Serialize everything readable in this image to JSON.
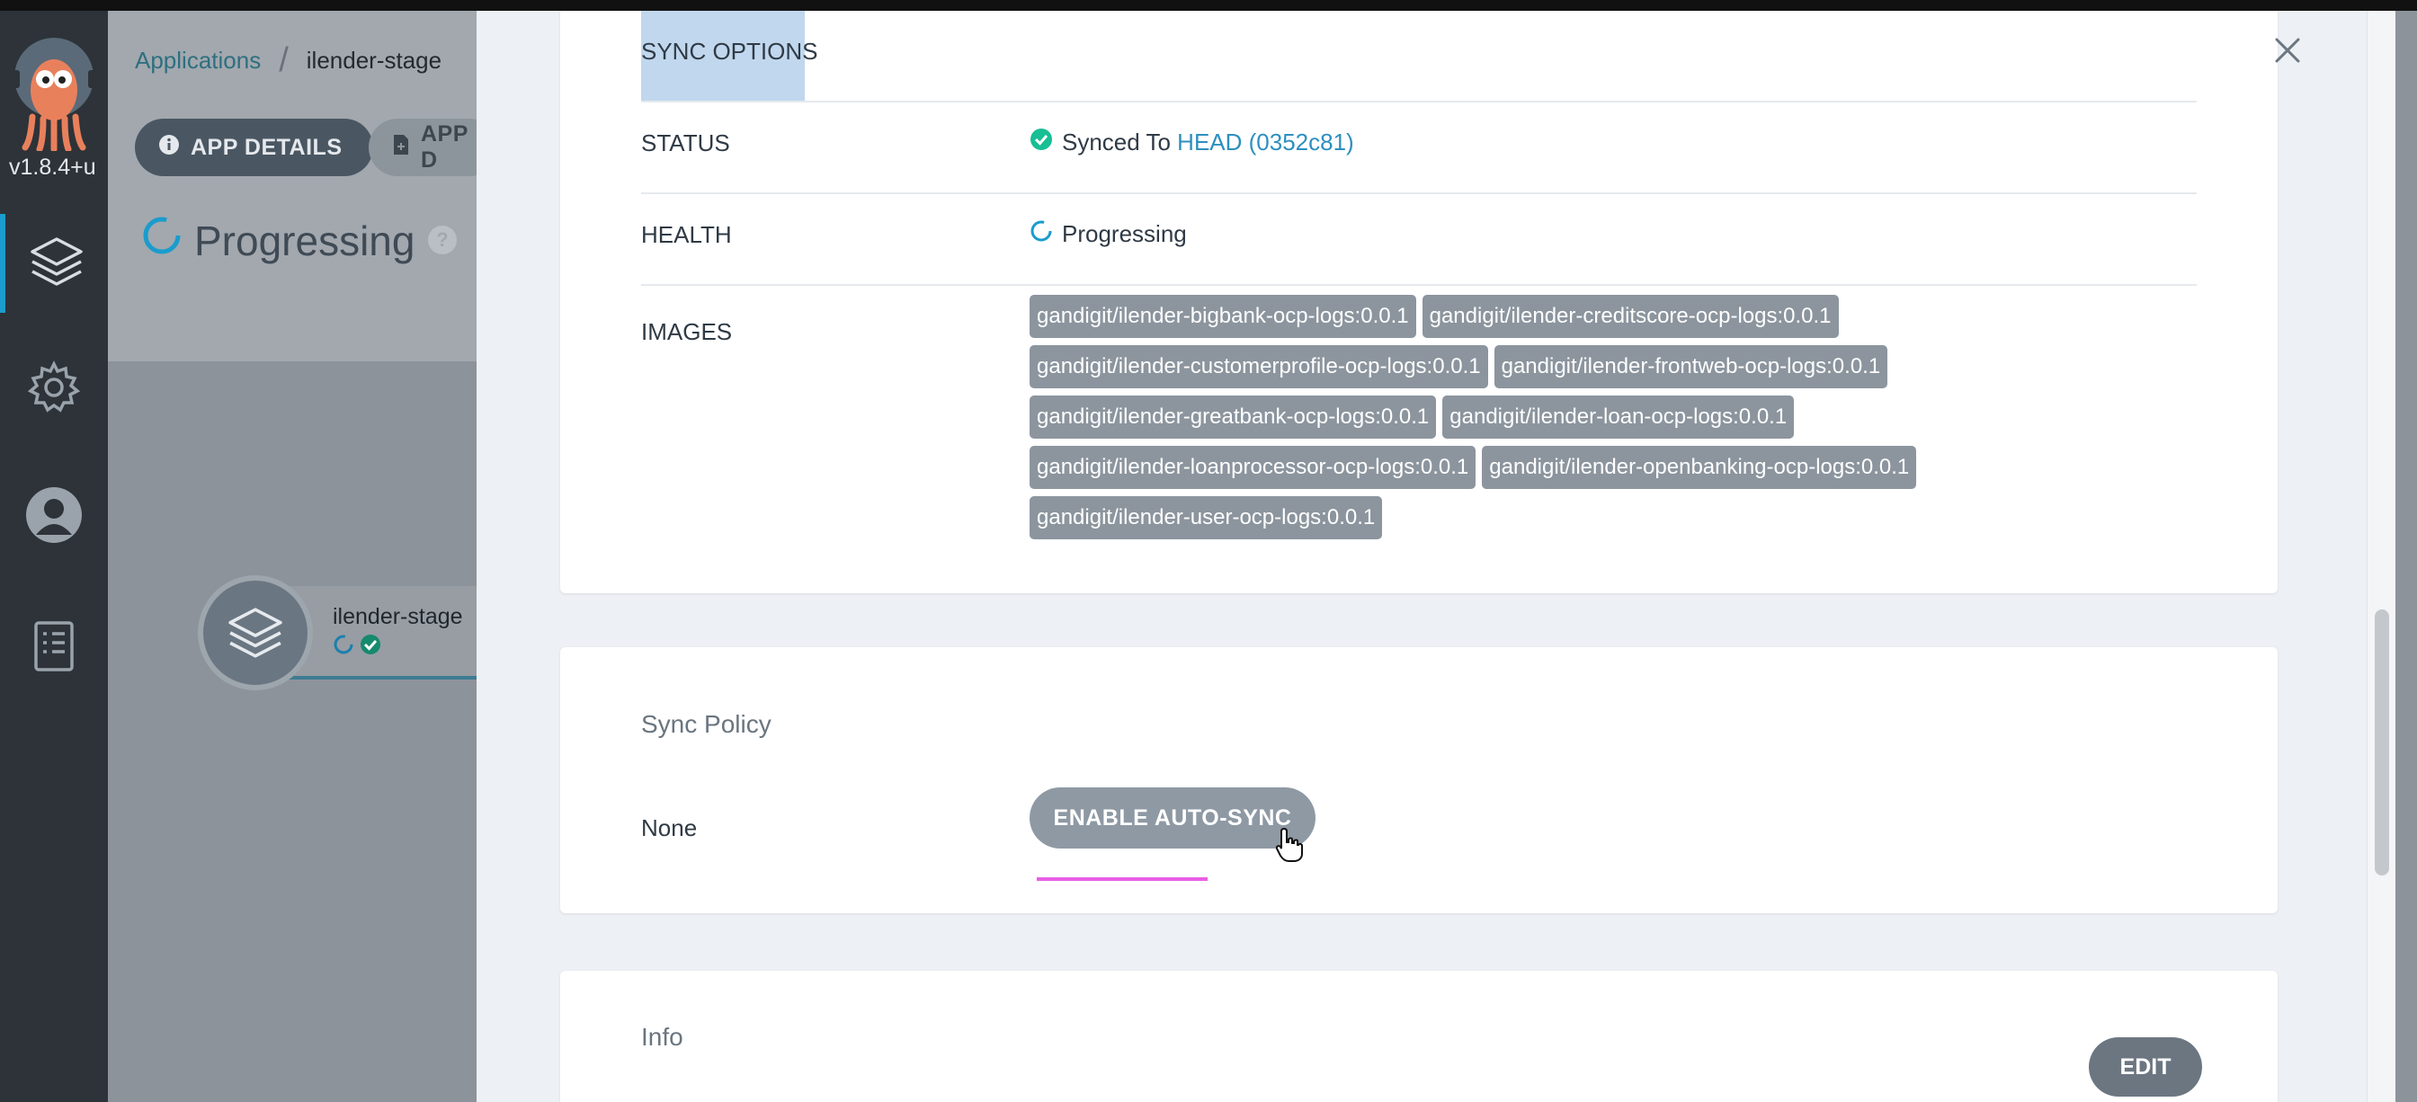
{
  "sidebar": {
    "version": "v1.8.4+u",
    "nav": [
      "applications-icon",
      "settings-icon",
      "user-icon",
      "docs-icon"
    ]
  },
  "background": {
    "breadcrumb": {
      "root": "Applications",
      "current": "ilender-stage"
    },
    "tabs": {
      "app_details": "APP DETAILS",
      "app_diff": "APP D"
    },
    "status_title": "Progressing",
    "node_label": "ilender-stage"
  },
  "summary": {
    "sync_options_label": "SYNC OPTIONS",
    "status_label": "STATUS",
    "status_prefix": "Synced To ",
    "status_link": "HEAD (0352c81)",
    "health_label": "HEALTH",
    "health_value": "Progressing",
    "images_label": "IMAGES",
    "images": [
      "gandigit/ilender-bigbank-ocp-logs:0.0.1",
      "gandigit/ilender-creditscore-ocp-logs:0.0.1",
      "gandigit/ilender-customerprofile-ocp-logs:0.0.1",
      "gandigit/ilender-frontweb-ocp-logs:0.0.1",
      "gandigit/ilender-greatbank-ocp-logs:0.0.1",
      "gandigit/ilender-loan-ocp-logs:0.0.1",
      "gandigit/ilender-loanprocessor-ocp-logs:0.0.1",
      "gandigit/ilender-openbanking-ocp-logs:0.0.1",
      "gandigit/ilender-user-ocp-logs:0.0.1"
    ]
  },
  "sync_policy": {
    "title": "Sync Policy",
    "value": "None",
    "button": "ENABLE AUTO-SYNC"
  },
  "info": {
    "title": "Info",
    "edit_button": "EDIT"
  },
  "colors": {
    "accent": "#2d8fbf",
    "synced": "#18be94",
    "progress": "#1b9ccd",
    "sidebar": "#2d3338",
    "tag": "#8c959e"
  }
}
